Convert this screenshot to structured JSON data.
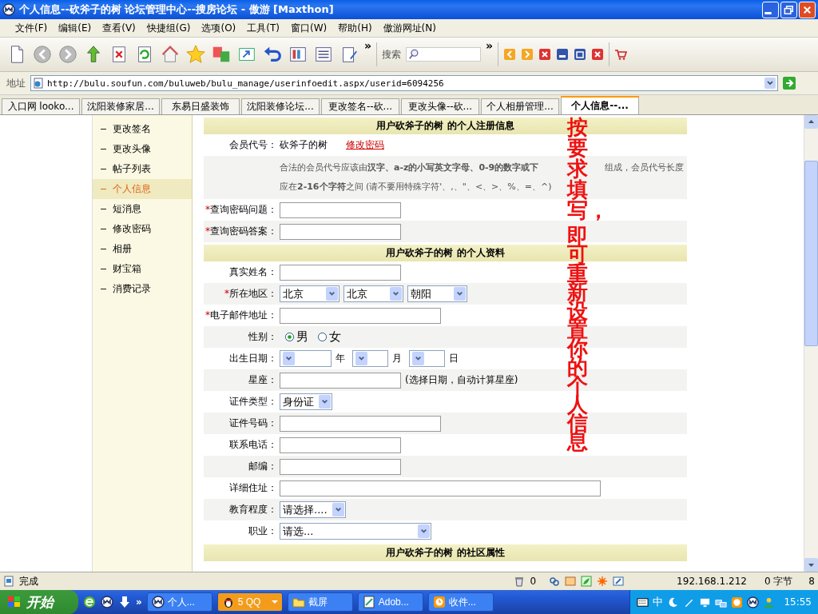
{
  "window": {
    "title": "个人信息--砍斧子的树 论坛管理中心--搜房论坛 - 傲游 [Maxthon]"
  },
  "menu": [
    "文件(F)",
    "编辑(E)",
    "查看(V)",
    "快捷组(G)",
    "选项(O)",
    "工具(T)",
    "窗口(W)",
    "帮助(H)",
    "傲游网址(N)"
  ],
  "toolbar": {
    "more": "»",
    "search_label": "搜索",
    "search_more": "»"
  },
  "address": {
    "label": "地址",
    "url": "http://bulu.soufun.com/buluweb/bulu_manage/userinfoedit.aspx/userid=6094256"
  },
  "tabs": [
    {
      "label": "入口网 looko...",
      "selected": false
    },
    {
      "label": "沈阳装修家居...",
      "selected": false
    },
    {
      "label": "东易日盛装饰",
      "selected": false
    },
    {
      "label": "沈阳装修论坛...",
      "selected": false
    },
    {
      "label": "更改签名--砍...",
      "selected": false
    },
    {
      "label": "更改头像--砍...",
      "selected": false
    },
    {
      "label": "个人相册管理...",
      "selected": false
    },
    {
      "label": "个人信息--...",
      "selected": true
    }
  ],
  "sidebar": {
    "items": [
      {
        "label": "更改签名",
        "selected": false
      },
      {
        "label": "更改头像",
        "selected": false
      },
      {
        "label": "帖子列表",
        "selected": false
      },
      {
        "label": "个人信息",
        "selected": true
      },
      {
        "label": "短消息",
        "selected": false
      },
      {
        "label": "修改密码",
        "selected": false
      },
      {
        "label": "相册",
        "selected": false
      },
      {
        "label": "财宝箱",
        "selected": false
      },
      {
        "label": "消费记录",
        "selected": false
      }
    ]
  },
  "sections": [
    {
      "title": "用户砍斧子的树 的个人注册信息",
      "rows": [
        {
          "kind": "static",
          "label": "会员代号：",
          "value": "砍斧子的树",
          "link": "修改密码"
        },
        {
          "kind": "note",
          "lines": [
            "合法的会员代号应该由**汉字、a-z的小写英文字母、0-9的数字或下**",
            "应在**2-16个字符**之间 (请不要用特殊字符'、,、\"、<、>、%、=、^)"
          ],
          "tail": "组成，会员代号长度"
        },
        {
          "kind": "text",
          "mark": "*",
          "label": "查询密码问题："
        },
        {
          "kind": "text",
          "mark": "*",
          "label": "查询密码答案："
        }
      ]
    },
    {
      "title": "用户砍斧子的树 的个人资料",
      "rows": [
        {
          "kind": "text",
          "label": "真实姓名："
        },
        {
          "kind": "selects",
          "mark": "*",
          "label": "所在地区：",
          "selects": [
            {
              "value": "北京"
            },
            {
              "value": "北京"
            },
            {
              "value": "朝阳"
            }
          ]
        },
        {
          "kind": "text",
          "mark": "*",
          "label": "电子邮件地址："
        },
        {
          "kind": "radio",
          "label": "性别：",
          "options": [
            {
              "label": "男",
              "selected": true
            },
            {
              "label": "女",
              "selected": false
            }
          ]
        },
        {
          "kind": "selects",
          "label": "出生日期：",
          "selects": [
            {
              "unit": "年"
            },
            {
              "unit": "月"
            },
            {
              "unit": "日"
            }
          ]
        },
        {
          "kind": "text",
          "label": "星座：",
          "hint": "(选择日期，自动计算星座)"
        },
        {
          "kind": "selects",
          "label": "证件类型：",
          "selects": [
            {
              "value": "身份证"
            }
          ]
        },
        {
          "kind": "text",
          "label": "证件号码："
        },
        {
          "kind": "text",
          "label": "联系电话："
        },
        {
          "kind": "text",
          "label": "邮编："
        },
        {
          "kind": "text",
          "label": "详细住址："
        },
        {
          "kind": "selects",
          "label": "教育程度：",
          "selects": [
            {
              "value": "请选择...."
            }
          ]
        },
        {
          "kind": "selects",
          "label": "职业：",
          "selects": [
            {
              "value": "请选..."
            }
          ]
        }
      ]
    },
    {
      "title": "用户砍斧子的树 的社区属性"
    }
  ],
  "overlay": [
    "按要求填写，",
    "即可重新设置你的个人信息"
  ],
  "status_bar": {
    "text": "完成",
    "count": "0",
    "ip": "192.168.1.212",
    "bytes": "0 字节",
    "zoom": "8"
  },
  "taskbar": {
    "start": "开始",
    "more": "»",
    "tasks": [
      {
        "label": "个人...",
        "flashing": false
      },
      {
        "label": "5 QQ",
        "flashing": true
      },
      {
        "label": "截屏",
        "flashing": false
      },
      {
        "label": "Adob...",
        "flashing": false
      },
      {
        "label": "收件...",
        "flashing": false
      }
    ],
    "ime": "中",
    "clock": "15:55"
  }
}
